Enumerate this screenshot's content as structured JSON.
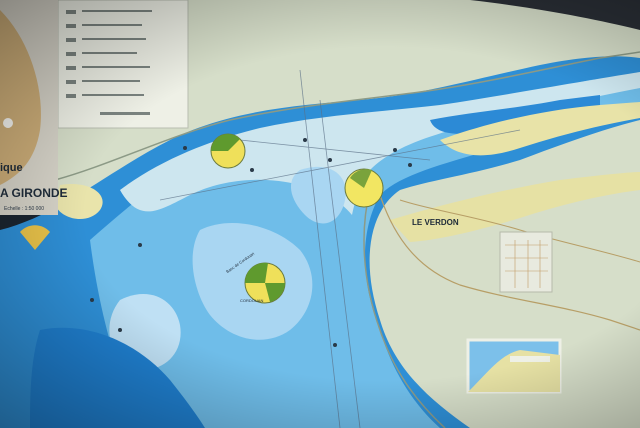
{
  "map": {
    "title_partial": "A GIRONDE",
    "subtitle_partial": "ique",
    "scale": "Echelle : 1:50 000",
    "town_label": "LE VERDON",
    "bank_label": "CORDOUAN",
    "shoal_label": "Banc de Cordouan"
  },
  "colors": {
    "land": "#d7dfca",
    "shallow": "#cfe6ee",
    "mid_water": "#7dc2e8",
    "deep_water": "#2f90d8",
    "sand": "#e6e1a6",
    "sector_yellow": "#f0e45c",
    "sector_green": "#5f9a2e"
  }
}
